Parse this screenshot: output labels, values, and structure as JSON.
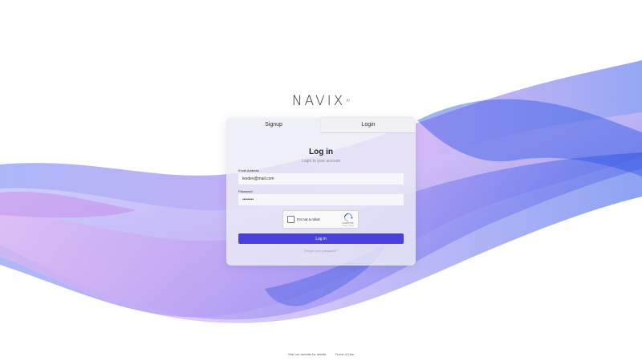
{
  "brand": {
    "name": "NAVIX",
    "suffix": "AI"
  },
  "tabs": {
    "signup": "Signup",
    "login": "Login",
    "active": "login"
  },
  "form": {
    "title": "Log in",
    "subtitle": "Login to your account",
    "email_label": "Email Address",
    "email_value": "lexdev@mail.com",
    "password_label": "Password",
    "password_value": "••••••••",
    "captcha_text": "I'm not a robot",
    "captcha_brand": "reCAPTCHA",
    "captcha_terms": "Privacy - Terms",
    "submit_label": "Log in",
    "forgot_label": "Forgot your password?"
  },
  "footer": {
    "website_link": "Visit our website for details",
    "terms_link": "Terms of Use"
  },
  "colors": {
    "accent": "#4a40e0",
    "wave_blue": "#3f5ee8",
    "wave_purple": "#b860e6"
  }
}
